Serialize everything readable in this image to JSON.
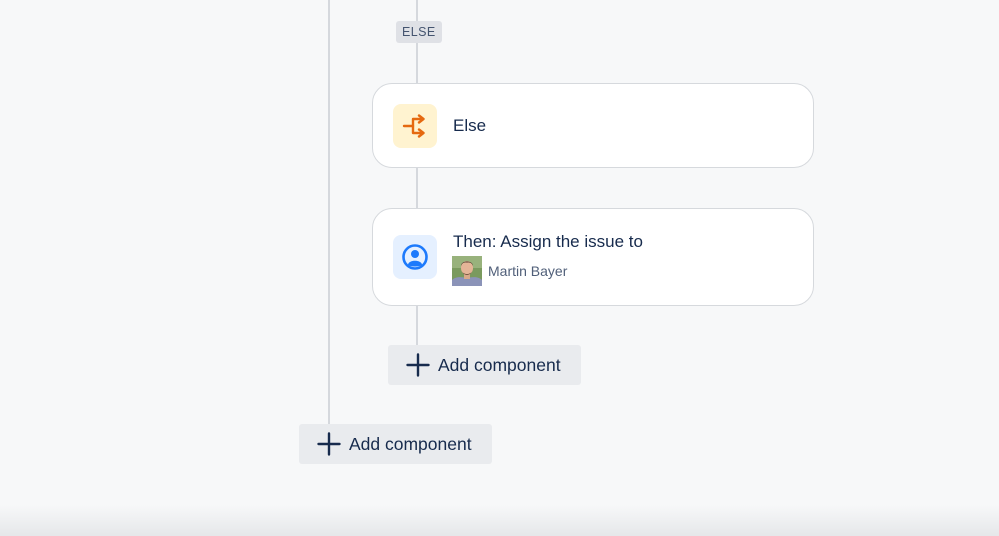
{
  "branch_badge": "ELSE",
  "else_card": {
    "title": "Else",
    "icon": "branch-condition-icon",
    "icon_color": "#e56910",
    "icon_bg": "#fff3d0"
  },
  "action_card": {
    "title": "Then: Assign the issue to",
    "icon": "user-circle-icon",
    "icon_color": "#1d7afc",
    "icon_bg": "#e5f0ff",
    "assignee": {
      "name": "Martin Bayer",
      "avatar": "user-avatar"
    }
  },
  "add_component_inner": {
    "label": "Add component",
    "icon": "plus-icon"
  },
  "add_component_outer": {
    "label": "Add component",
    "icon": "plus-icon"
  },
  "colors": {
    "background": "#f7f8f9",
    "connector_line": "#d5d8dd",
    "card_border": "#d6d9dd",
    "text_primary": "#172b4d",
    "text_secondary": "#505f79",
    "button_bg": "#e9ebee"
  }
}
